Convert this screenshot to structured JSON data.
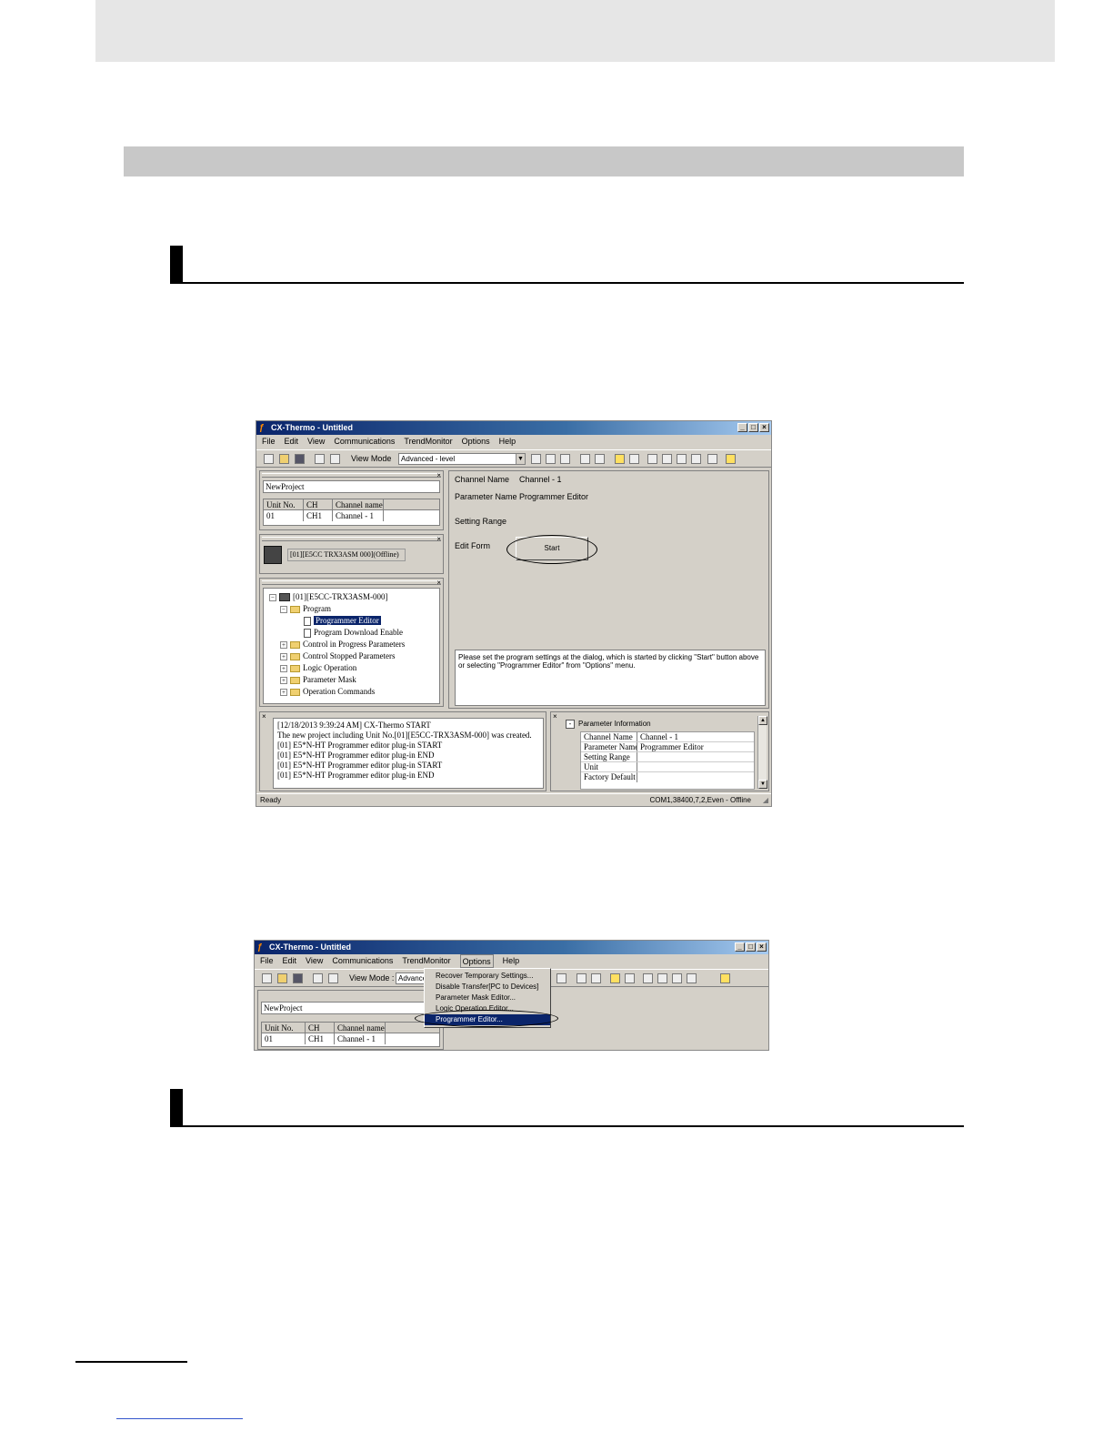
{
  "window1": {
    "title": "CX-Thermo - Untitled",
    "menu": [
      "File",
      "Edit",
      "View",
      "Communications",
      "TrendMonitor",
      "Options",
      "Help"
    ],
    "toolbar": {
      "view_mode_label": "View Mode",
      "view_mode_value": "Advanced - level"
    },
    "project_name": "NewProject",
    "unit_grid": {
      "headers": [
        "Unit No.",
        "CH",
        "Channel name"
      ],
      "rows": [
        [
          "01",
          "CH1",
          "Channel - 1"
        ]
      ]
    },
    "device_label": "[01][E5CC TRX3ASM 000](Offline)",
    "tree": {
      "root": "[01][E5CC-TRX3ASM-000]",
      "program": "Program",
      "programmer_editor": "Programmer Editor",
      "program_download": "Program Download Enable",
      "control_in_progress": "Control in Progress Parameters",
      "control_stopped": "Control Stopped Parameters",
      "logic_operation": "Logic Operation",
      "parameter_mask": "Parameter Mask",
      "operation_commands": "Operation Commands"
    },
    "right": {
      "channel_name_label": "Channel Name",
      "channel_name_value": "Channel - 1",
      "parameter_name_label": "Parameter Name",
      "parameter_name_value": "Programmer Editor",
      "setting_range_label": "Setting Range",
      "edit_form_label": "Edit Form",
      "start_button": "Start",
      "description": "Please set the program settings at the dialog, which is started by clicking \"Start\" button above or selecting \"Programmer Editor\" from \"Options\" menu."
    },
    "log": [
      "[12/18/2013 9:39:24 AM] CX-Thermo START",
      "The new project including Unit No.[01][E5CC-TRX3ASM-000] was created.",
      "[01] E5*N-HT Programmer editor plug-in START",
      "[01] E5*N-HT Programmer editor plug-in END",
      "[01] E5*N-HT Programmer editor plug-in START",
      "[01] E5*N-HT Programmer editor plug-in END"
    ],
    "param_info": {
      "title": "Parameter Information",
      "rows": [
        [
          "Channel Name",
          "Channel - 1"
        ],
        [
          "Parameter Name",
          "Programmer Editor"
        ],
        [
          "Setting Range",
          ""
        ],
        [
          "Unit",
          ""
        ],
        [
          "Factory Default",
          ""
        ]
      ]
    },
    "status_left": "Ready",
    "status_right": "COM1,38400,7,2,Even - Offline"
  },
  "window2": {
    "title": "CX-Thermo - Untitled",
    "menu": [
      "File",
      "Edit",
      "View",
      "Communications",
      "TrendMonitor",
      "Options",
      "Help"
    ],
    "view_mode_label": "View Mode :",
    "view_mode_value": "Advance",
    "project_name": "NewProject",
    "unit_grid": {
      "headers": [
        "Unit No.",
        "CH",
        "Channel name"
      ],
      "rows": [
        [
          "01",
          "CH1",
          "Channel - 1"
        ]
      ]
    },
    "options_menu": [
      "Recover Temporary Settings...",
      "Disable Transfer[PC to Devices]",
      "Parameter Mask Editor...",
      "Logic Operation Editor...",
      "Programmer Editor..."
    ]
  }
}
